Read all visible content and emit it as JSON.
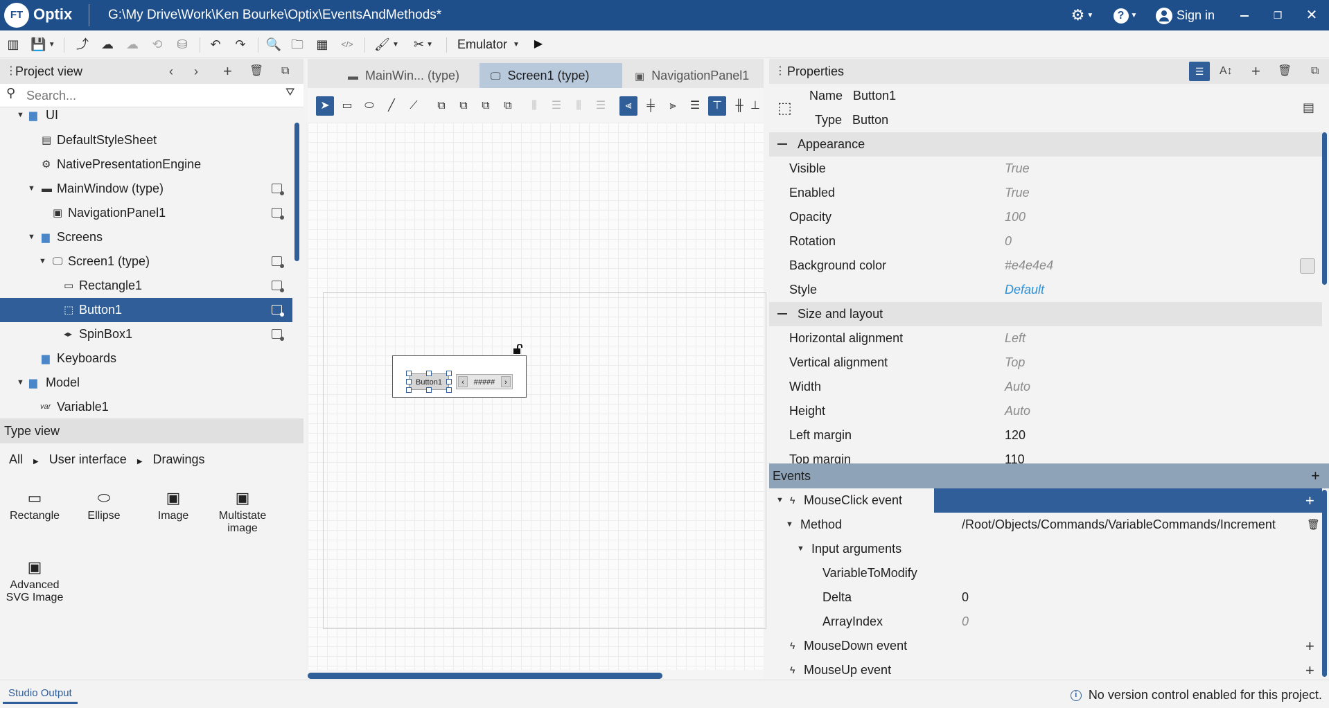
{
  "app": {
    "logo_mark": "FT",
    "logo_text": "Optix",
    "window_path": "G:\\My Drive\\Work\\Ken Bourke\\Optix\\EventsAndMethods*",
    "sign_in": "Sign in",
    "accent": "#1f4f8b",
    "selection": "#2f5e98"
  },
  "toolbar": {
    "icons": [
      "layout-icon",
      "save-icon",
      "deploy-icon",
      "upload-icon",
      "cloud-icon",
      "history-icon",
      "database-icon",
      "undo-icon",
      "redo-icon",
      "find-icon",
      "open-folder-icon",
      "library-icon",
      "code-icon",
      "brush-icon",
      "tools-icon",
      "play-icon"
    ],
    "emulator_label": "Emulator"
  },
  "project_view": {
    "title": "Project view",
    "search_placeholder": "Search...",
    "tree": [
      {
        "label": "UI",
        "icon": "folder-icon",
        "expanded": true
      },
      {
        "label": "DefaultStyleSheet",
        "icon": "stylesheet-icon"
      },
      {
        "label": "NativePresentationEngine",
        "icon": "gear-icon"
      },
      {
        "label": "MainWindow (type)",
        "icon": "window-icon",
        "expanded": true
      },
      {
        "label": "NavigationPanel1",
        "icon": "navigation-panel-icon"
      },
      {
        "label": "Screens",
        "icon": "folder-icon",
        "expanded": true
      },
      {
        "label": "Screen1 (type)",
        "icon": "screen-icon",
        "expanded": true
      },
      {
        "label": "Rectangle1",
        "icon": "rectangle-icon"
      },
      {
        "label": "Button1",
        "icon": "button-icon",
        "selected": true
      },
      {
        "label": "SpinBox1",
        "icon": "spinbox-icon"
      },
      {
        "label": "Keyboards",
        "icon": "folder-icon"
      },
      {
        "label": "Model",
        "icon": "folder-icon",
        "expanded": true
      },
      {
        "label": "Variable1",
        "icon": "variable-icon",
        "prefix": "var"
      }
    ]
  },
  "type_view": {
    "title": "Type view",
    "breadcrumb": [
      "All",
      "User interface",
      "Drawings"
    ],
    "tiles": [
      {
        "label": "Rectangle",
        "glyph": "▭"
      },
      {
        "label": "Ellipse",
        "glyph": "⬭"
      },
      {
        "label": "Image",
        "glyph": "▣"
      },
      {
        "label": "Multistate image",
        "glyph": "▣"
      },
      {
        "label": "Advanced SVG Image",
        "glyph": "▣"
      }
    ]
  },
  "editor": {
    "tabs": [
      {
        "label": "MainWin... (type)",
        "active": false
      },
      {
        "label": "Screen1 (type)",
        "active": true
      },
      {
        "label": "NavigationPanel1",
        "active": false
      }
    ],
    "button_text": "Button1",
    "spinbox_text": "#####"
  },
  "properties": {
    "title": "Properties",
    "name_label": "Name",
    "name_value": "Button1",
    "type_label": "Type",
    "type_value": "Button",
    "sections": [
      {
        "title": "Appearance",
        "rows": [
          {
            "label": "Visible",
            "value": "True"
          },
          {
            "label": "Enabled",
            "value": "True"
          },
          {
            "label": "Opacity",
            "value": "100"
          },
          {
            "label": "Rotation",
            "value": "0"
          },
          {
            "label": "Background color",
            "value": "#e4e4e4",
            "swatch": "#e4e4e4"
          },
          {
            "label": "Style",
            "value": "Default",
            "link": true
          }
        ]
      },
      {
        "title": "Size and layout",
        "rows": [
          {
            "label": "Horizontal alignment",
            "value": "Left"
          },
          {
            "label": "Vertical alignment",
            "value": "Top"
          },
          {
            "label": "Width",
            "value": "Auto"
          },
          {
            "label": "Height",
            "value": "Auto"
          },
          {
            "label": "Left margin",
            "value": "120",
            "set": true
          },
          {
            "label": "Top margin",
            "value": "110",
            "set": true
          }
        ]
      }
    ]
  },
  "events": {
    "title": "Events",
    "mouse_click": "MouseClick event",
    "method_label": "Method",
    "method_value": "/Root/Objects/Commands/VariableCommands/Increment",
    "input_arguments": "Input arguments",
    "args": [
      {
        "label": "VariableToModify",
        "value": ""
      },
      {
        "label": "Delta",
        "value": "0"
      },
      {
        "label": "ArrayIndex",
        "value": "0"
      }
    ],
    "mouse_down": "MouseDown event",
    "mouse_up": "MouseUp event"
  },
  "status": {
    "studio_output": "Studio Output",
    "version_control": "No version control enabled for this project."
  }
}
